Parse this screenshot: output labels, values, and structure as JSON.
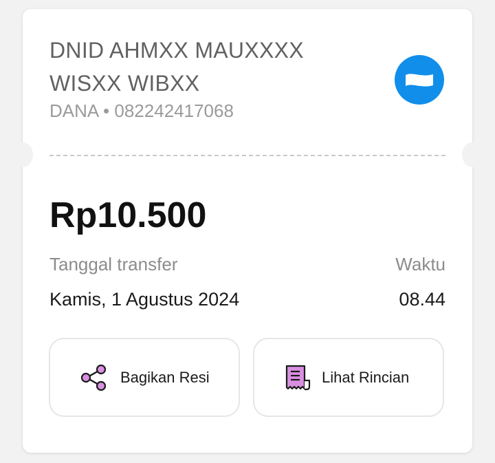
{
  "recipient": {
    "name": "DNID AHMXX MAUXXXX WISXX WIBXX",
    "bank": "DANA",
    "separator": "•",
    "account_number": "082242417068",
    "logo_icon": "dana-logo-icon",
    "logo_color": "#118eea"
  },
  "transfer": {
    "amount": "Rp10.500",
    "date_label": "Tanggal transfer",
    "date_value": "Kamis, 1 Agustus 2024",
    "time_label": "Waktu",
    "time_value": "08.44"
  },
  "actions": {
    "share_label": "Bagikan Resi",
    "share_icon": "share-icon",
    "detail_label": "Lihat Rincian",
    "detail_icon": "receipt-icon",
    "icon_color": "#d98fe0"
  }
}
